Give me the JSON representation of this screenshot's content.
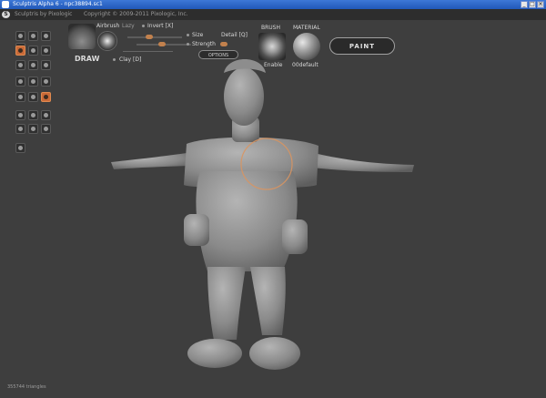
{
  "window": {
    "title": "Sculptris Alpha 6 - npc38894.sc1",
    "buttons": [
      "_",
      "□",
      "×"
    ]
  },
  "appbar": {
    "name": "Sculptris by Pixologic",
    "copyright": "Copyright © 2009-2011 Pixologic, Inc."
  },
  "brush": {
    "mode_label": "DRAW",
    "airbrush_label": "Airbrush",
    "lazy_label": "Lazy",
    "invert_label": "Invert [X]",
    "size_label": "Size",
    "detail_label": "Detail [Q]",
    "strength_label": "Strength",
    "clay_label": "Clay [D]",
    "options_label": "OPTIONS",
    "brush_header": "BRUSH",
    "brush_name": "Enable",
    "material_header": "MATERIAL",
    "material_name": "00default",
    "paint_label": "PAINT"
  },
  "status": {
    "triangles": "355744 triangles"
  },
  "colors": {
    "accent": "#c96a38",
    "background": "#3e3e3e",
    "titlebar": "#2158b8",
    "model": "#9a9a9a"
  },
  "tools": [
    {
      "icon": "scale-icon",
      "selected": false
    },
    {
      "icon": "rotate-icon",
      "selected": false
    },
    {
      "icon": "grab-icon",
      "selected": false
    },
    {
      "icon": "crease-icon",
      "selected": false
    },
    {
      "icon": "draw-icon",
      "selected": true
    },
    {
      "icon": "flatten-icon",
      "selected": false
    },
    {
      "icon": "inflate-icon",
      "selected": false
    },
    {
      "icon": "pinch-icon",
      "selected": false
    },
    {
      "icon": "smooth-icon",
      "selected": false
    },
    {
      "icon": "reduce-icon",
      "selected": false
    },
    {
      "icon": "mask-icon",
      "selected": false
    },
    {
      "icon": "symmetry-icon",
      "selected": true
    }
  ]
}
